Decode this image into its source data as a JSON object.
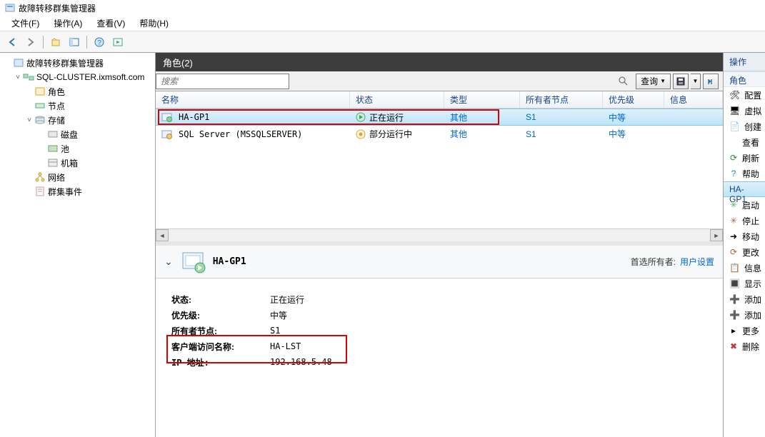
{
  "window": {
    "title": "故障转移群集管理器"
  },
  "menu": {
    "file": "文件(F)",
    "action": "操作(A)",
    "view": "查看(V)",
    "help": "帮助(H)"
  },
  "tree": {
    "root": "故障转移群集管理器",
    "cluster": "SQL-CLUSTER.ixmsoft.com",
    "roles": "角色",
    "nodes": "节点",
    "storage": "存储",
    "disks": "磁盘",
    "pools": "池",
    "enclosures": "机箱",
    "networks": "网络",
    "events": "群集事件"
  },
  "center": {
    "header": "角色(2)",
    "search_placeholder": "搜索",
    "query_btn": "查询",
    "columns": {
      "name": "名称",
      "status": "状态",
      "type": "类型",
      "owner": "所有者节点",
      "priority": "优先级",
      "info": "信息"
    },
    "rows": [
      {
        "name": "HA-GP1",
        "status": "正在运行",
        "type": "其他",
        "owner": "S1",
        "priority": "中等"
      },
      {
        "name": "SQL Server (MSSQLSERVER)",
        "status": "部分运行中",
        "type": "其他",
        "owner": "S1",
        "priority": "中等"
      }
    ]
  },
  "detail": {
    "title": "HA-GP1",
    "preferred_owner_label": "首选所有者:",
    "preferred_owner_value": "用户设置",
    "rows": {
      "status_k": "状态:",
      "status_v": "正在运行",
      "priority_k": "优先级:",
      "priority_v": "中等",
      "owner_k": "所有者节点:",
      "owner_v": "S1",
      "client_k": "客户端访问名称:",
      "client_v": "HA-LST",
      "ip_k": "IP 地址:",
      "ip_v": "192.168.5.48"
    }
  },
  "actions": {
    "header": "操作",
    "section_roles": "角色",
    "items_roles": {
      "configure": "配置",
      "vm": "虚拟",
      "create": "创建",
      "view": "查看",
      "refresh": "刷新",
      "help": "帮助"
    },
    "section_sel": "HA-GP1",
    "items_sel": {
      "start": "启动",
      "stop": "停止",
      "move": "移动",
      "change": "更改",
      "info": "信息",
      "show": "显示",
      "add": "添加",
      "add2": "添加",
      "more": "更多",
      "delete": "删除"
    }
  }
}
